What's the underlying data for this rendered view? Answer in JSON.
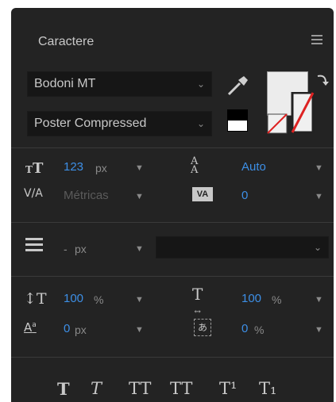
{
  "panel": {
    "title": "Caractere",
    "menu_icon": "hamburger-menu-icon"
  },
  "font": {
    "family": "Bodoni MT",
    "style": "Poster Compressed"
  },
  "colors": {
    "fill": "#eeeeee",
    "stroke": "none",
    "accent_blue": "#3d8fe6",
    "panel_bg": "#232323"
  },
  "metrics": {
    "size_value": "123",
    "size_unit": "px",
    "leading_value": "Auto",
    "kerning_value": "Métricas",
    "tracking_value": "0"
  },
  "stroke": {
    "width_value": "-",
    "width_unit": "px"
  },
  "scale": {
    "vertical_value": "100",
    "vertical_unit": "%",
    "horizontal_value": "100",
    "horizontal_unit": "%",
    "baseline_value": "0",
    "baseline_unit": "px",
    "tsume_value": "0",
    "tsume_unit": "%"
  },
  "format_buttons": [
    "T",
    "T",
    "TT",
    "TT",
    "T¹",
    "T₁"
  ]
}
